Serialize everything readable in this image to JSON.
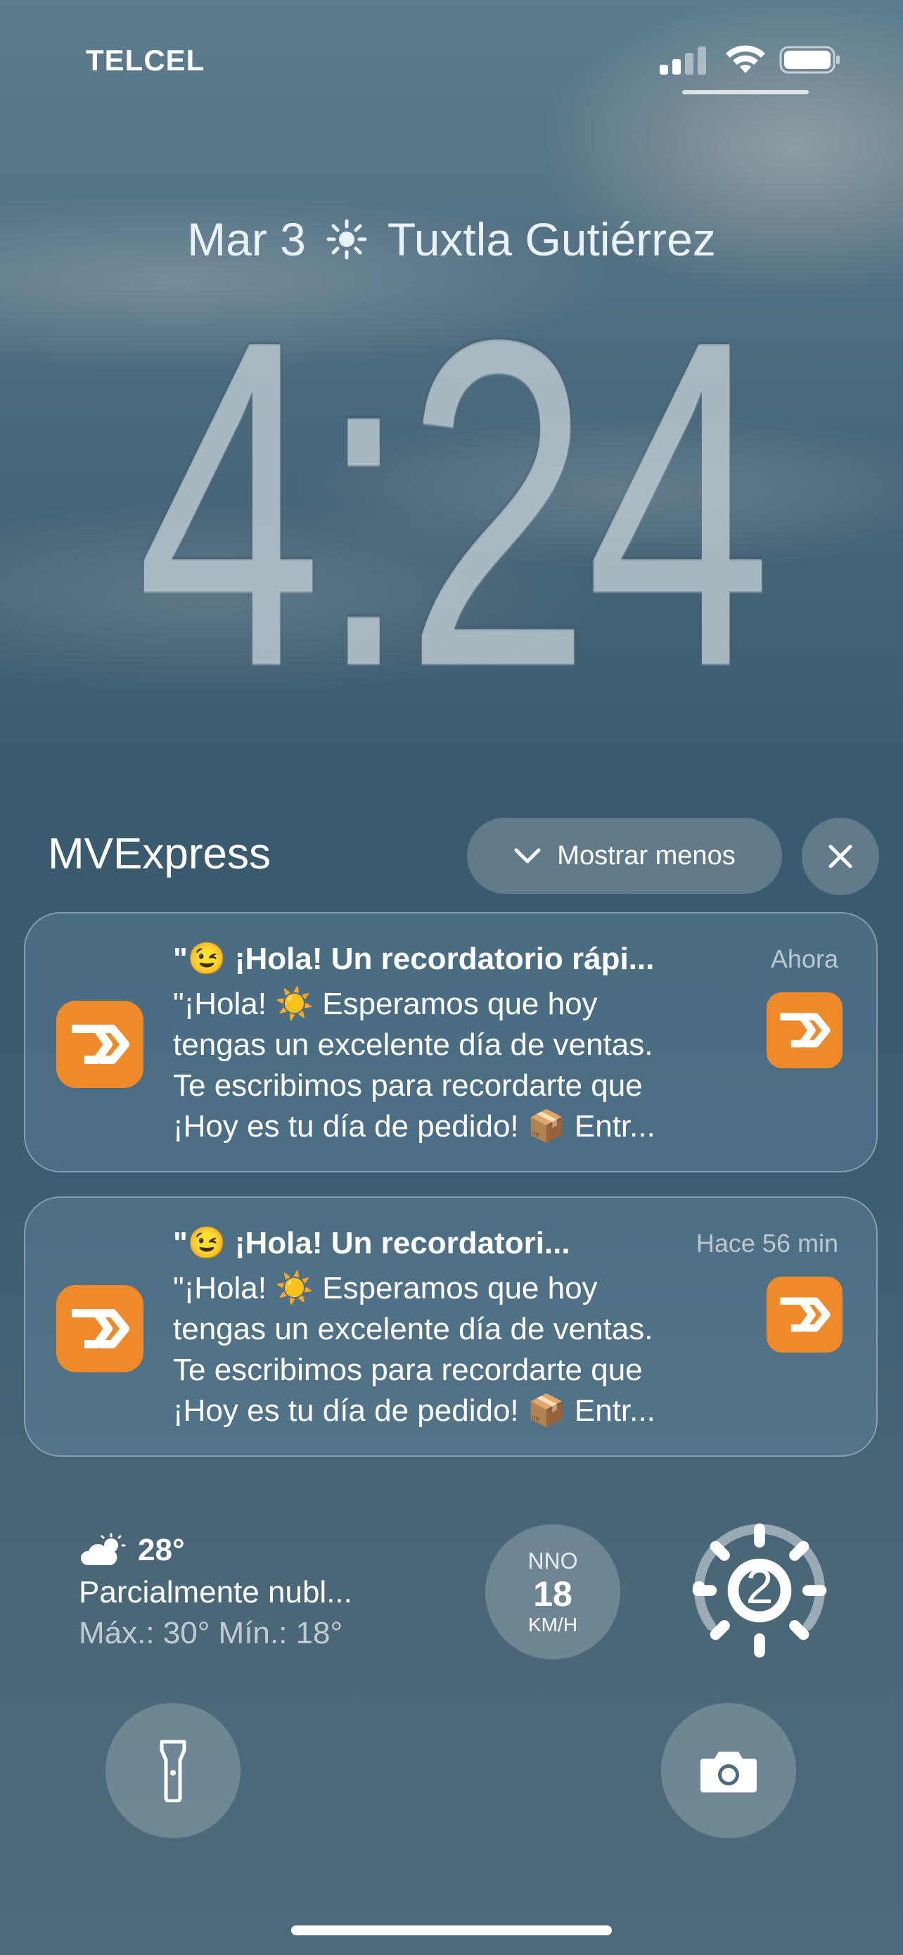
{
  "status_bar": {
    "carrier": "TELCEL",
    "signal_icon": "cellular-signal-icon",
    "wifi_icon": "wifi-icon",
    "battery_icon": "battery-icon"
  },
  "lock_screen": {
    "date": "Mar 3",
    "weather_icon": "sun-icon",
    "location": "Tuxtla Gutiérrez",
    "time": "4:24"
  },
  "notification_group": {
    "app_name": "MVExpress",
    "show_less_label": "Mostrar menos",
    "close_icon": "close-icon",
    "notifications": [
      {
        "title": "\"😉 ¡Hola! Un recordatorio rápi...",
        "time": "Ahora",
        "body_lines": [
          "\"¡Hola! ☀️ Esperamos que hoy",
          "tengas un excelente día de ventas.",
          "Te escribimos para recordarte que",
          "¡Hoy es tu día de pedido! 📦 Entr..."
        ]
      },
      {
        "title": "\"😉 ¡Hola! Un recordatori...",
        "time": "Hace 56 min",
        "body_lines": [
          "\"¡Hola! ☀️ Esperamos que hoy",
          "tengas un excelente día de ventas.",
          "Te escribimos para recordarte que",
          "¡Hoy es tu día de pedido! 📦 Entr..."
        ]
      }
    ],
    "accent_color": "#ef8a2a"
  },
  "widgets": {
    "weather": {
      "icon": "partly-cloudy-icon",
      "temperature": "28°",
      "condition": "Parcialmente nubl...",
      "range": "Máx.: 30° Mín.: 18°"
    },
    "wind": {
      "direction": "NNO",
      "speed": "18",
      "unit": "KM/H"
    },
    "uv": {
      "value": "2",
      "icon": "sun-icon"
    }
  },
  "quick_actions": {
    "flashlight_icon": "flashlight-icon",
    "camera_icon": "camera-icon"
  }
}
